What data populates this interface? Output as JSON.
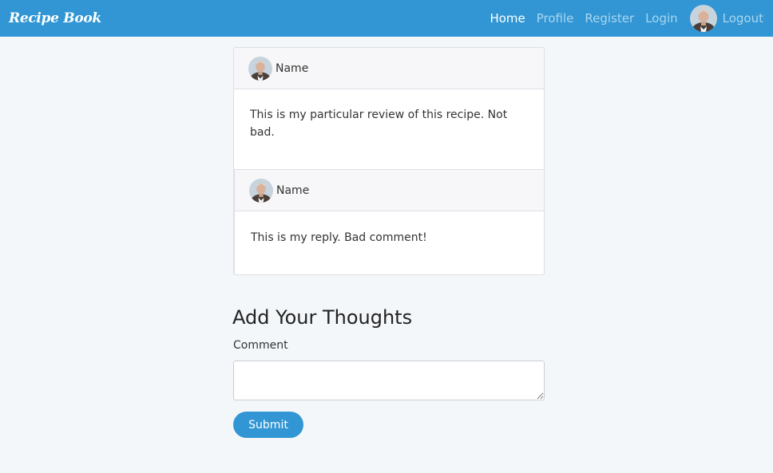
{
  "navbar": {
    "brand": "Recipe Book",
    "links": [
      "Home",
      "Profile",
      "Register",
      "Login"
    ],
    "logout": "Logout"
  },
  "comments": {
    "items": [
      {
        "author": "Name",
        "text": "This is my particular review of this recipe. Not bad."
      },
      {
        "author": "Name",
        "text": "This is my reply. Bad comment!"
      }
    ]
  },
  "form": {
    "title": "Add Your Thoughts",
    "label": "Comment",
    "value": "",
    "submit": "Submit"
  }
}
